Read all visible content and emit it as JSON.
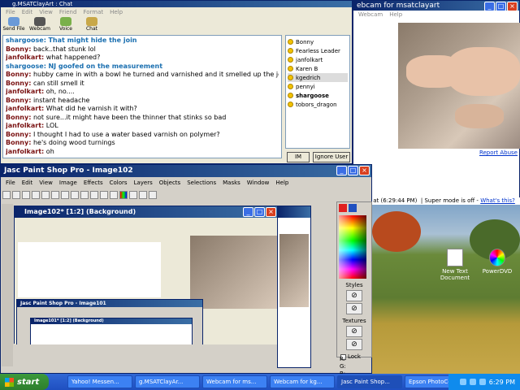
{
  "chat": {
    "title": "g.MSATClayArt : Chat",
    "menu": [
      "File",
      "Edit",
      "View",
      "Friend",
      "Format",
      "Help"
    ],
    "tools": [
      {
        "label": "Send File",
        "icon": "send-file-icon"
      },
      {
        "label": "Webcam",
        "icon": "webcam-icon"
      },
      {
        "label": "Voice",
        "icon": "voice-icon"
      },
      {
        "label": "Chat",
        "icon": "chat-icon"
      }
    ],
    "messages": [
      {
        "name": "shargoose:",
        "text": "That might hide the join",
        "kind": "a"
      },
      {
        "name": "Bonny:",
        "text": "back..that stunk lol",
        "kind": "b"
      },
      {
        "name": "janfolkart:",
        "text": "what happened?",
        "kind": "b"
      },
      {
        "name": "shargoose:",
        "text": "NJ goofed on the measurement",
        "kind": "a"
      },
      {
        "name": "Bonny:",
        "text": "hubby came in with a bowl he turned and varnished and it smelled up the joint",
        "kind": "b"
      },
      {
        "name": "Bonny:",
        "text": "can still smell it",
        "kind": "b"
      },
      {
        "name": "janfolkart:",
        "text": "oh, no....",
        "kind": "b"
      },
      {
        "name": "Bonny:",
        "text": "instant headache",
        "kind": "b"
      },
      {
        "name": "janfolkart:",
        "text": "What did he varnish it with?",
        "kind": "b"
      },
      {
        "name": "Bonny:",
        "text": "not sure...it might have been the thinner that stinks so bad",
        "kind": "b"
      },
      {
        "name": "janfolkart:",
        "text": "LOL",
        "kind": "b"
      },
      {
        "name": "Bonny:",
        "text": "I thought I had to use a water based varnish on polymer?",
        "kind": "b"
      },
      {
        "name": "Bonny:",
        "text": "he's doing wood turnings",
        "kind": "b"
      },
      {
        "name": "janfolkart:",
        "text": "oh",
        "kind": "b"
      }
    ],
    "buddies": [
      "Bonny",
      "Fearless Leader",
      "janfolkart",
      "Karen B",
      "kgedrich",
      "pennyi",
      "shargoose",
      "tobors_dragon"
    ],
    "im_button": "IM",
    "ignore_button": "Ignore User"
  },
  "webcam": {
    "title": "ebcam for msatclayart",
    "menu": [
      "Webcam",
      "Help"
    ],
    "report_link": "Report Abuse",
    "status": "ceived at (6:29:44 PM)",
    "super_mode": "Super mode is off -",
    "whats_this": "What's this?"
  },
  "psp": {
    "title": "Jasc Paint Shop Pro - Image102",
    "menu": [
      "File",
      "Edit",
      "View",
      "Image",
      "Effects",
      "Colors",
      "Layers",
      "Objects",
      "Selections",
      "Masks",
      "Window",
      "Help"
    ],
    "image_title": "Image102* [1:2] (Background)",
    "nested_title": "Jasc Paint Shop Pro - Image101",
    "nested_image_title": "Image101* [1:2] (Background)",
    "palette": {
      "styles": "Styles",
      "textures": "Textures",
      "lock": "Lock",
      "bottom_lines": [
        "R:",
        "G:",
        "B:"
      ]
    },
    "colors": {
      "fg": "#e02020",
      "bg": "#2050c0"
    }
  },
  "desktop": {
    "icons": [
      {
        "label": "New Text Document",
        "icon": "text-document-icon"
      },
      {
        "label": "PowerDVD",
        "icon": "powerdvd-icon"
      }
    ]
  },
  "taskbar": {
    "start": "start",
    "tasks": [
      {
        "label": "Yahoo! Messen...",
        "active": false
      },
      {
        "label": "g.MSATClayAr...",
        "active": false
      },
      {
        "label": "Webcam for ms...",
        "active": false
      },
      {
        "label": "Webcam for kg...",
        "active": false
      },
      {
        "label": "Jasc Paint Shop...",
        "active": true
      },
      {
        "label": "Epson PhotoCe...",
        "active": false
      }
    ],
    "clock": "6:29 PM"
  }
}
